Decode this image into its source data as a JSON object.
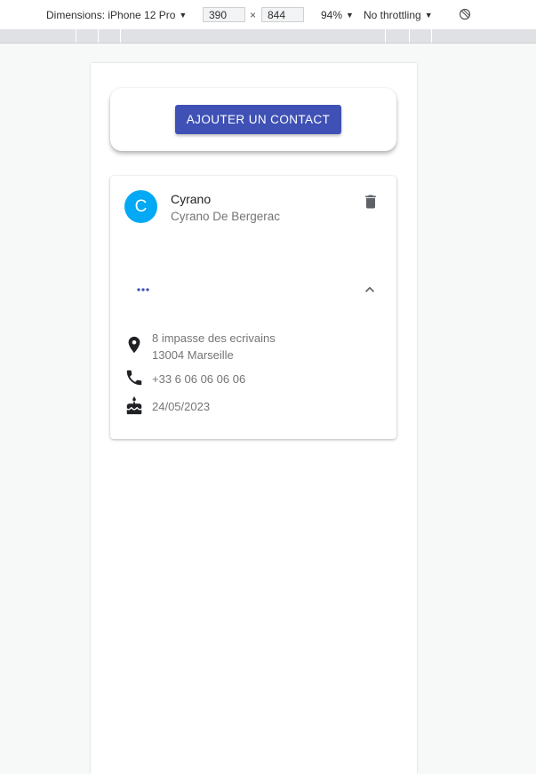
{
  "devtools": {
    "dimensions_label": "Dimensions: iPhone 12 Pro",
    "width": "390",
    "height": "844",
    "times": "×",
    "zoom": "94%",
    "throttling": "No throttling",
    "rotate_icon": "rotate-disabled-icon"
  },
  "app": {
    "add_button": "AJOUTER UN CONTACT",
    "contact": {
      "avatar_letter": "C",
      "name": "Cyrano",
      "full_name": "Cyrano De Bergerac",
      "address_line1": "8 impasse des ecrivains",
      "address_line2": "13004 Marseille",
      "phone": "+33 6 06 06 06 06",
      "birthday": "24/05/2023"
    },
    "colors": {
      "primary": "#3f51b5",
      "avatar": "#03a9f4",
      "icon": "#5f6368"
    }
  }
}
